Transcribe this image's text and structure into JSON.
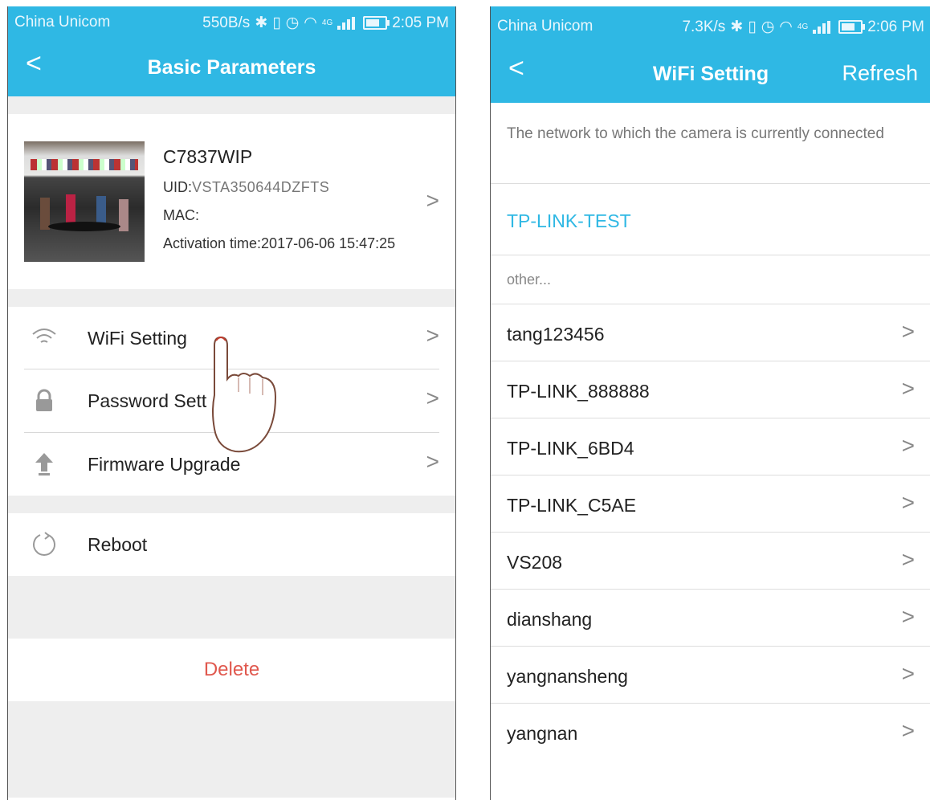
{
  "left": {
    "status": {
      "carrier": "China Unicom",
      "speed": "550B/s",
      "net": "4G",
      "time": "2:05 PM"
    },
    "title": "Basic Parameters",
    "device": {
      "name": "C7837WIP",
      "uid_label": "UID:",
      "uid_value": "VSTA350644DZFTS",
      "mac_label": "MAC:",
      "activation": "Activation time:2017-06-06 15:47:25"
    },
    "menu": [
      {
        "label": "WiFi Setting",
        "icon": "wifi-icon"
      },
      {
        "label": "Password Sett",
        "icon": "lock-icon"
      },
      {
        "label": "Firmware Upgrade",
        "icon": "upload-icon"
      }
    ],
    "reboot": {
      "label": "Reboot",
      "icon": "refresh-icon"
    },
    "delete_label": "Delete"
  },
  "right": {
    "status": {
      "carrier": "China Unicom",
      "speed": "7.3K/s",
      "net": "4G",
      "time": "2:06 PM"
    },
    "title": "WiFi Setting",
    "refresh_label": "Refresh",
    "hint": "The network to which the camera is currently connected",
    "current_network": "TP-LINK-TEST",
    "other_label": "other...",
    "networks": [
      "tang123456",
      "TP-LINK_888888",
      "TP-LINK_6BD4",
      "TP-LINK_C5AE",
      "VS208",
      "dianshang",
      "yangnansheng",
      "yangnan"
    ]
  },
  "colors": {
    "accent": "#2fb8e4",
    "delete": "#e0584e"
  }
}
